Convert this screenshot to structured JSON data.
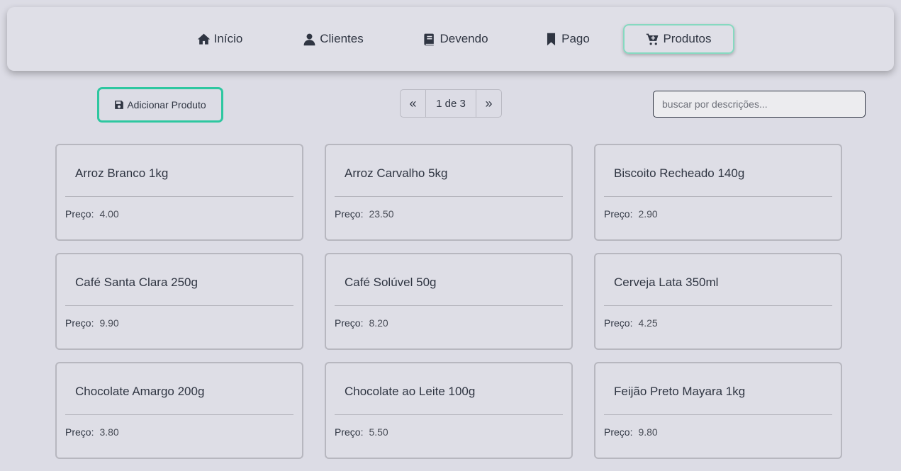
{
  "nav": {
    "items": [
      {
        "label": "Início",
        "icon": "home-icon"
      },
      {
        "label": "Clientes",
        "icon": "user-icon"
      },
      {
        "label": "Devendo",
        "icon": "book-icon"
      },
      {
        "label": "Pago",
        "icon": "bookmark-icon"
      },
      {
        "label": "Produtos",
        "icon": "cart-plus-icon",
        "active": true
      }
    ]
  },
  "toolbar": {
    "add_label": "Adicionar Produto",
    "add_icon": "save-icon",
    "search_placeholder": "buscar por descrições..."
  },
  "pagination": {
    "prev": "«",
    "current": "1 de 3",
    "next": "»"
  },
  "price_label": "Preço:",
  "products": [
    {
      "name": "Arroz Branco 1kg",
      "price": "4.00"
    },
    {
      "name": "Arroz Carvalho 5kg",
      "price": "23.50"
    },
    {
      "name": "Biscoito Recheado 140g",
      "price": "2.90"
    },
    {
      "name": "Café Santa Clara 250g",
      "price": "9.90"
    },
    {
      "name": "Café Solúvel 50g",
      "price": "8.20"
    },
    {
      "name": "Cerveja Lata 350ml",
      "price": "4.25"
    },
    {
      "name": "Chocolate Amargo 200g",
      "price": "3.80"
    },
    {
      "name": "Chocolate ao Leite 100g",
      "price": "5.50"
    },
    {
      "name": "Feijão Preto Mayara 1kg",
      "price": "9.80"
    }
  ],
  "colors": {
    "background": "#dcdce5",
    "accent": "#2ec7a0",
    "text": "#2f3542"
  }
}
